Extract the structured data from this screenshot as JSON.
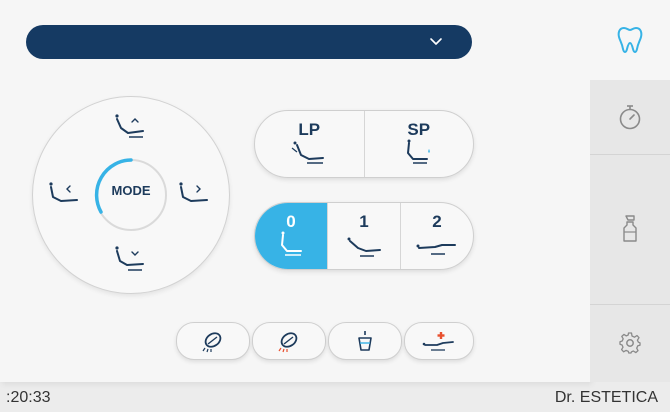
{
  "colors": {
    "accent": "#37b3e6",
    "navy": "#153a63",
    "text": "#1d3b5c",
    "warning": "#e8502e"
  },
  "top_selector": {
    "value": "",
    "icon": "chevron-down-icon"
  },
  "sidebar": {
    "items": [
      {
        "icon": "tooth-icon",
        "active": true
      },
      {
        "icon": "timer-icon",
        "active": false
      },
      {
        "icon": "spray-bottle-icon",
        "active": false
      },
      {
        "icon": "gear-icon",
        "active": false
      }
    ]
  },
  "position_dial": {
    "center_label": "MODE",
    "buttons": [
      "chair-up",
      "chair-left",
      "chair-right",
      "chair-down"
    ]
  },
  "program_group": {
    "buttons": [
      {
        "label": "LP",
        "icon": "chair-last-position-icon"
      },
      {
        "label": "SP",
        "icon": "chair-spittoon-position-icon"
      }
    ]
  },
  "memory_group": {
    "buttons": [
      {
        "label": "0",
        "icon": "chair-upright-icon",
        "active": true
      },
      {
        "label": "1",
        "icon": "chair-reclined-icon",
        "active": false
      },
      {
        "label": "2",
        "icon": "chair-flat-icon",
        "active": false
      }
    ]
  },
  "bottom_buttons": [
    {
      "icon": "operating-light-icon"
    },
    {
      "icon": "operating-light-composite-icon"
    },
    {
      "icon": "cup-fill-icon"
    },
    {
      "icon": "emergency-position-icon"
    }
  ],
  "status_bar": {
    "time": ":20:33",
    "user": "Dr. ESTETICA"
  }
}
